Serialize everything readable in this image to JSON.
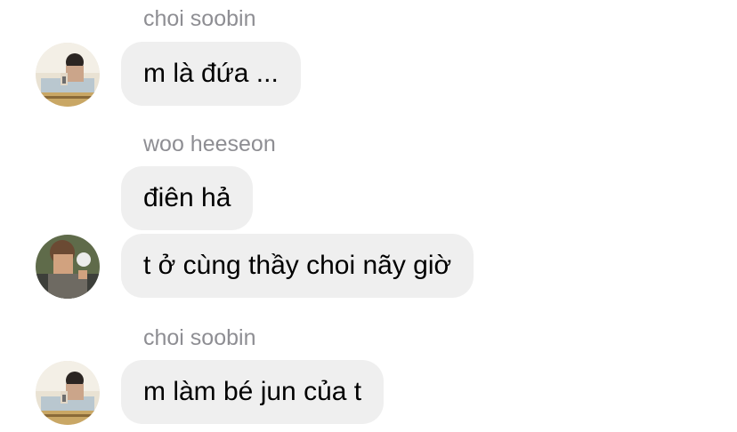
{
  "messages": [
    {
      "sender": "choi soobin",
      "text": "m là đứa ..."
    },
    {
      "sender": "woo heeseon",
      "text": "điên hả"
    },
    {
      "text": "t ở cùng thầy choi nãy giờ"
    },
    {
      "sender": "choi soobin",
      "text": "m làm bé jun của t"
    }
  ],
  "colors": {
    "bubble": "#efefef",
    "sender_name": "#8e8e93",
    "text": "#000000"
  },
  "icons": [
    "avatar-choi-soobin",
    "avatar-woo-heeseon"
  ]
}
